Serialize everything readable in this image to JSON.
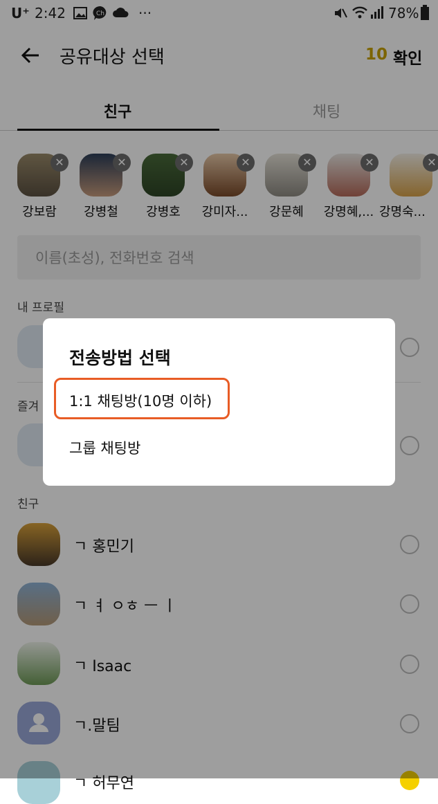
{
  "status_bar": {
    "carrier": "U⁺",
    "time": "2:42",
    "extra": "···",
    "battery": "78%"
  },
  "header": {
    "title": "공유대상 선택",
    "count": "10",
    "confirm_label": "확인"
  },
  "tabs": [
    {
      "label": "친구",
      "active": true
    },
    {
      "label": "채팅",
      "active": false
    }
  ],
  "selected_chips": [
    {
      "name": "강보람"
    },
    {
      "name": "강병철"
    },
    {
      "name": "강병호"
    },
    {
      "name": "강미자..."
    },
    {
      "name": "강문혜"
    },
    {
      "name": "강명혜,..."
    },
    {
      "name": "강명숙..."
    }
  ],
  "search": {
    "placeholder": "이름(초성), 전화번호 검색"
  },
  "sections": {
    "my_profile": "내 프로필",
    "favorites": "즐겨",
    "friends": "친구"
  },
  "friends": [
    {
      "name": "ㄱ 홍민기"
    },
    {
      "name": "ㄱ ㅕ ㅇㅎ ㅡ ㅣ"
    },
    {
      "name": "ㄱ Isaac"
    },
    {
      "name": "ㄱ.말팀"
    },
    {
      "name": "ㄱ 허무연"
    }
  ],
  "dialog": {
    "title": "전송방법 선택",
    "option_one_to_one": "1:1 채팅방(10명 이하)",
    "option_group": "그룹 채팅방"
  },
  "colors": {
    "accent": "#c9a200",
    "highlight": "#e85c25",
    "overlay": "rgba(0,0,0,0.38)"
  }
}
